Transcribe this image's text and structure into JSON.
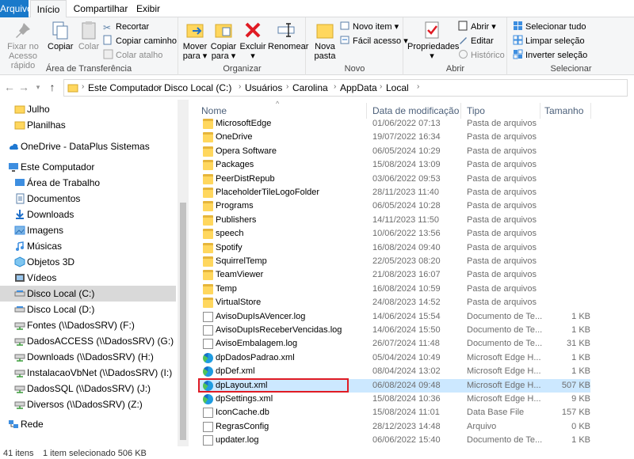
{
  "tabs": {
    "file": "Arquivo",
    "home": "Início",
    "share": "Compartilhar",
    "view": "Exibir"
  },
  "ribbon": {
    "clipboard": {
      "label": "Área de Transferência",
      "pin": "Fixar no Acesso rápido",
      "copy": "Copiar",
      "paste": "Colar",
      "cut": "Recortar",
      "copy_path": "Copiar caminho",
      "paste_shortcut": "Colar atalho"
    },
    "organize": {
      "label": "Organizar",
      "move_to": "Mover para",
      "copy_to": "Copiar para",
      "delete": "Excluir",
      "rename": "Renomear"
    },
    "new": {
      "label": "Novo",
      "new_folder": "Nova pasta",
      "new_item": "Novo item",
      "easy_access": "Fácil acesso"
    },
    "open": {
      "label": "Abrir",
      "properties": "Propriedades",
      "open": "Abrir",
      "edit": "Editar",
      "history": "Histórico"
    },
    "select": {
      "label": "Selecionar",
      "select_all": "Selecionar tudo",
      "select_none": "Limpar seleção",
      "invert": "Inverter seleção"
    }
  },
  "address": {
    "crumbs": [
      "Este Computador",
      "Disco Local (C:)",
      "Usuários",
      "Carolina",
      "AppData",
      "Local"
    ]
  },
  "nav": {
    "items": [
      {
        "label": "Julho",
        "icon": "folder-icon"
      },
      {
        "label": "Planilhas",
        "icon": "folder-icon"
      },
      {
        "label": "OneDrive - DataPlus Sistemas",
        "icon": "onedrive-icon"
      },
      {
        "label": "Este Computador",
        "icon": "computer-icon"
      },
      {
        "label": "Área de Trabalho",
        "icon": "desktop-icon"
      },
      {
        "label": "Documentos",
        "icon": "documents-icon"
      },
      {
        "label": "Downloads",
        "icon": "downloads-icon"
      },
      {
        "label": "Imagens",
        "icon": "pictures-icon"
      },
      {
        "label": "Músicas",
        "icon": "music-icon"
      },
      {
        "label": "Objetos 3D",
        "icon": "3d-objects-icon"
      },
      {
        "label": "Vídeos",
        "icon": "videos-icon"
      },
      {
        "label": "Disco Local (C:)",
        "icon": "drive-icon"
      },
      {
        "label": "Disco Local (D:)",
        "icon": "drive-icon"
      },
      {
        "label": "Fontes (\\\\DadosSRV) (F:)",
        "icon": "network-drive-icon"
      },
      {
        "label": "DadosACCESS (\\\\DadosSRV) (G:)",
        "icon": "network-drive-icon"
      },
      {
        "label": "Downloads (\\\\DadosSRV) (H:)",
        "icon": "network-drive-icon"
      },
      {
        "label": "InstalacaoVbNet (\\\\DadosSRV) (I:)",
        "icon": "network-drive-icon"
      },
      {
        "label": "DadosSQL (\\\\DadosSRV) (J:)",
        "icon": "network-drive-icon"
      },
      {
        "label": "Diversos (\\\\DadosSRV) (Z:)",
        "icon": "network-drive-icon"
      },
      {
        "label": "Rede",
        "icon": "network-icon"
      }
    ],
    "selected_index": 11
  },
  "list": {
    "columns": {
      "name": "Nome",
      "date": "Data de modificação",
      "type": "Tipo",
      "size": "Tamanho"
    },
    "files": [
      {
        "name": "MicrosoftEdge",
        "date": "01/06/2022 07:13",
        "type": "Pasta de arquivos",
        "size": "",
        "kind": "folder"
      },
      {
        "name": "OneDrive",
        "date": "19/07/2022 16:34",
        "type": "Pasta de arquivos",
        "size": "",
        "kind": "folder"
      },
      {
        "name": "Opera Software",
        "date": "06/05/2024 10:29",
        "type": "Pasta de arquivos",
        "size": "",
        "kind": "folder"
      },
      {
        "name": "Packages",
        "date": "15/08/2024 13:09",
        "type": "Pasta de arquivos",
        "size": "",
        "kind": "folder"
      },
      {
        "name": "PeerDistRepub",
        "date": "03/06/2022 09:53",
        "type": "Pasta de arquivos",
        "size": "",
        "kind": "folder"
      },
      {
        "name": "PlaceholderTileLogoFolder",
        "date": "28/11/2023 11:40",
        "type": "Pasta de arquivos",
        "size": "",
        "kind": "folder"
      },
      {
        "name": "Programs",
        "date": "06/05/2024 10:28",
        "type": "Pasta de arquivos",
        "size": "",
        "kind": "folder"
      },
      {
        "name": "Publishers",
        "date": "14/11/2023 11:50",
        "type": "Pasta de arquivos",
        "size": "",
        "kind": "folder"
      },
      {
        "name": "speech",
        "date": "10/06/2022 13:56",
        "type": "Pasta de arquivos",
        "size": "",
        "kind": "folder"
      },
      {
        "name": "Spotify",
        "date": "16/08/2024 09:40",
        "type": "Pasta de arquivos",
        "size": "",
        "kind": "folder"
      },
      {
        "name": "SquirrelTemp",
        "date": "22/05/2023 08:20",
        "type": "Pasta de arquivos",
        "size": "",
        "kind": "folder"
      },
      {
        "name": "TeamViewer",
        "date": "21/08/2023 16:07",
        "type": "Pasta de arquivos",
        "size": "",
        "kind": "folder"
      },
      {
        "name": "Temp",
        "date": "16/08/2024 10:59",
        "type": "Pasta de arquivos",
        "size": "",
        "kind": "folder"
      },
      {
        "name": "VirtualStore",
        "date": "24/08/2023 14:52",
        "type": "Pasta de arquivos",
        "size": "",
        "kind": "folder"
      },
      {
        "name": "AvisoDupIsAVencer.log",
        "date": "14/06/2024 15:54",
        "type": "Documento de Te...",
        "size": "1 KB",
        "kind": "doc"
      },
      {
        "name": "AvisoDupIsReceberVencidas.log",
        "date": "14/06/2024 15:50",
        "type": "Documento de Te...",
        "size": "1 KB",
        "kind": "doc"
      },
      {
        "name": "AvisoEmbalagem.log",
        "date": "26/07/2024 11:48",
        "type": "Documento de Te...",
        "size": "31 KB",
        "kind": "doc"
      },
      {
        "name": "dpDadosPadrao.xml",
        "date": "05/04/2024 10:49",
        "type": "Microsoft Edge H...",
        "size": "1 KB",
        "kind": "edge"
      },
      {
        "name": "dpDef.xml",
        "date": "08/04/2024 13:02",
        "type": "Microsoft Edge H...",
        "size": "1 KB",
        "kind": "edge"
      },
      {
        "name": "dpLayout.xml",
        "date": "06/08/2024 09:48",
        "type": "Microsoft Edge H...",
        "size": "507 KB",
        "kind": "edge"
      },
      {
        "name": "dpSettings.xml",
        "date": "15/08/2024 10:36",
        "type": "Microsoft Edge H...",
        "size": "9 KB",
        "kind": "edge"
      },
      {
        "name": "IconCache.db",
        "date": "15/08/2024 11:01",
        "type": "Data Base File",
        "size": "157 KB",
        "kind": "doc"
      },
      {
        "name": "RegrasConfig",
        "date": "28/12/2023 14:48",
        "type": "Arquivo",
        "size": "0 KB",
        "kind": "doc"
      },
      {
        "name": "updater.log",
        "date": "06/06/2022 15:40",
        "type": "Documento de Te...",
        "size": "1 KB",
        "kind": "doc"
      }
    ],
    "selected_index": 19
  },
  "status": {
    "count": "41 itens",
    "selection": "1 item selecionado  506 KB"
  }
}
